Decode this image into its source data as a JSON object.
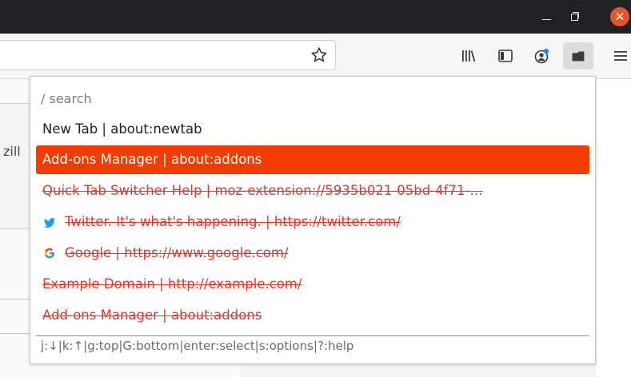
{
  "window": {
    "close_glyph": "✕"
  },
  "toolbar": {
    "icons": [
      "star-icon",
      "library-icon",
      "sidebar-icon",
      "account-icon",
      "tab-switcher-extension-icon",
      "hamburger-menu-icon"
    ]
  },
  "page_fragment": {
    "text": "zill"
  },
  "popup": {
    "search_text": "/ search",
    "rows": [
      {
        "label": "New Tab | about:newtab",
        "state": "normal",
        "icon": ""
      },
      {
        "label": "Add-ons Manager | about:addons",
        "state": "selected",
        "icon": ""
      },
      {
        "label": "Quick Tab Switcher Help | moz-extension://5935b021-05bd-4f71-…",
        "state": "struck",
        "icon": ""
      },
      {
        "label": "Twitter. It's what's happening. | https://twitter.com/",
        "state": "struck",
        "icon": "twitter-icon"
      },
      {
        "label": "Google | https://www.google.com/",
        "state": "struck",
        "icon": "google-icon"
      },
      {
        "label": "Example Domain | http://example.com/",
        "state": "struck",
        "icon": ""
      },
      {
        "label": "Add-ons Manager | about:addons",
        "state": "struck",
        "icon": ""
      }
    ],
    "help_text": "j:↓|k:↑|g:top|G:bottom|enter:select|s:options|?:help"
  },
  "colors": {
    "titlebar": "#202124",
    "selected_row": "#f43c00",
    "struck_text": "#e2372b",
    "twitter_blue": "#1d9bf0",
    "close_button": "#e9542c"
  }
}
